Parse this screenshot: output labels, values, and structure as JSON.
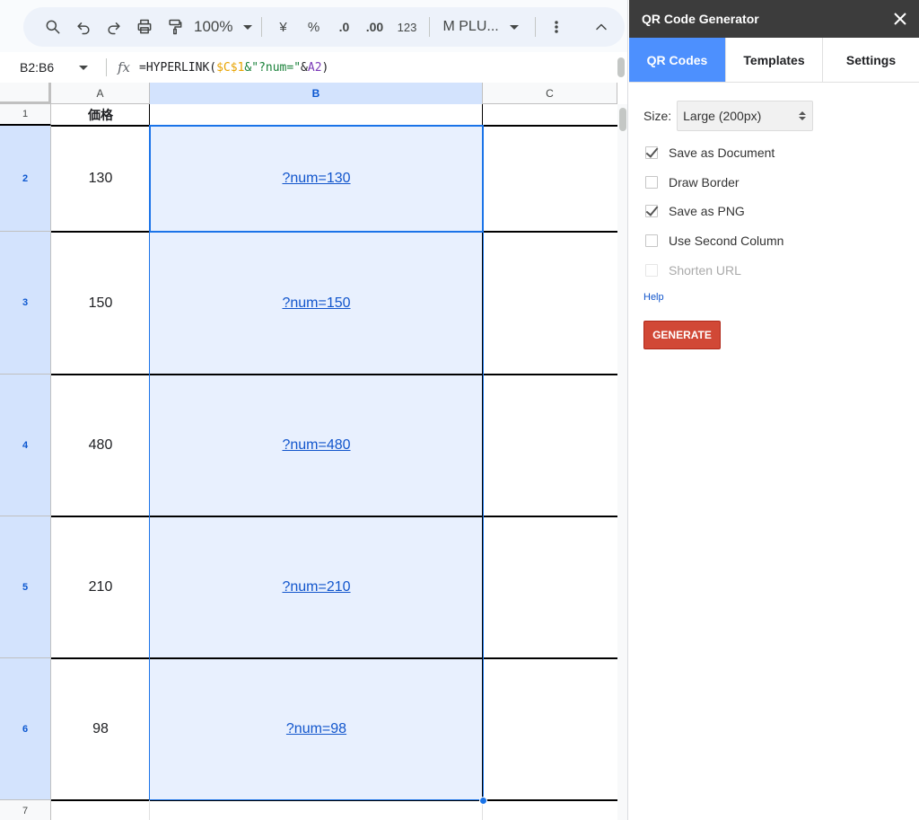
{
  "toolbar": {
    "zoom": "100%",
    "currency": "¥",
    "percent": "%",
    "decrease_decimal": ".0",
    "increase_decimal": ".00",
    "format_number": "123",
    "font": "M PLU..."
  },
  "formula_bar": {
    "name_box": "B2:B6",
    "fx": "fx",
    "formula_parts": [
      "=HYPERLINK(",
      "$C$1",
      "&\"?num=\"",
      "&",
      "A2",
      ")"
    ]
  },
  "columns": [
    "A",
    "B",
    "C"
  ],
  "rows": [
    "1",
    "2",
    "3",
    "4",
    "5",
    "6",
    "7"
  ],
  "cells": {
    "a1": "価格",
    "a": [
      "130",
      "150",
      "480",
      "210",
      "98"
    ],
    "b": [
      "?num=130",
      "?num=150",
      "?num=480",
      "?num=210",
      "?num=98"
    ]
  },
  "sidebar": {
    "title": "QR Code Generator",
    "tabs": [
      "QR Codes",
      "Templates",
      "Settings"
    ],
    "active_tab": 0,
    "size_label": "Size:",
    "size_value": "Large (200px)",
    "options": [
      {
        "label": "Save as Document",
        "checked": true,
        "disabled": false
      },
      {
        "label": "Draw Border",
        "checked": false,
        "disabled": false
      },
      {
        "label": "Save as PNG",
        "checked": true,
        "disabled": false
      },
      {
        "label": "Use Second Column",
        "checked": false,
        "disabled": false
      },
      {
        "label": "Shorten URL",
        "checked": false,
        "disabled": true
      }
    ],
    "help": "Help",
    "generate": "GENERATE",
    "accent_color": "#4d90fe",
    "generate_color": "#d14836"
  },
  "selection_color": "#1a73e8"
}
